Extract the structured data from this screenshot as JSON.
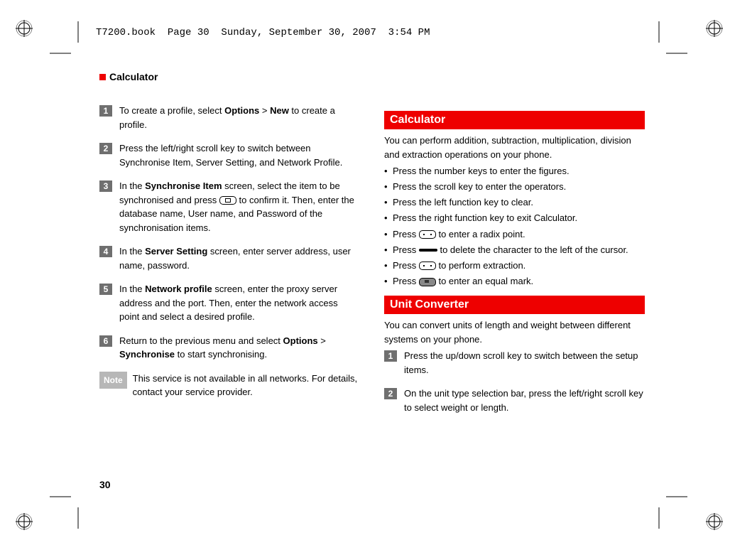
{
  "header_runner": "T7200.book  Page 30  Sunday, September 30, 2007  3:54 PM",
  "section_header": "Calculator",
  "page_number": "30",
  "left": {
    "steps": [
      {
        "n": "1",
        "pre": "To create a profile, select ",
        "b1": "Options",
        "mid": " > ",
        "b2": "New",
        "post": " to create a profile."
      },
      {
        "n": "2",
        "text": "Press the left/right scroll key to switch between Synchronise Item, Server Setting, and Network Profile."
      },
      {
        "n": "3",
        "pre": "In the ",
        "b1": "Synchronise Item",
        "mid": " screen, select the item to be synchronised and press ",
        "post": " to confirm it. Then, enter the database name, User name, and Password of the synchronisation items."
      },
      {
        "n": "4",
        "pre": "In the ",
        "b1": "Server Setting",
        "post": " screen, enter server address,  user name, password."
      },
      {
        "n": "5",
        "pre": "In the ",
        "b1": "Network profile",
        "post": " screen, enter the proxy server address and the port. Then, enter the network access point and select a desired profile."
      },
      {
        "n": "6",
        "pre": "Return to the previous menu and select ",
        "b1": "Options",
        "mid": " > ",
        "b2": "Synchronise",
        "post": " to start synchronising."
      }
    ],
    "note_label": "Note",
    "note_text": "This service is not available in all networks. For details, contact your service provider."
  },
  "right": {
    "calc_heading": "Calculator",
    "calc_intro": "You can perform addition, subtraction, multiplication, division and extraction operations on your phone.",
    "calc_bullets": [
      "Press the number keys to enter the figures.",
      "Press the scroll key to enter the operators.",
      "Press the left function key to clear.",
      "Press the right function key to exit Calculator."
    ],
    "calc_b5_pre": "Press ",
    "calc_b5_post": " to enter a radix point.",
    "calc_b6_pre": "Press ",
    "calc_b6_post": " to delete the character to the left of the cursor.",
    "calc_b7_pre": "Press ",
    "calc_b7_post": " to perform extraction.",
    "calc_b8_pre": "Press ",
    "calc_b8_post": " to enter an equal mark.",
    "unit_heading": "Unit Converter",
    "unit_intro": "You can convert units of length and weight between different systems on your phone.",
    "unit_steps": [
      {
        "n": "1",
        "text": "Press the up/down scroll key to switch between the setup items."
      },
      {
        "n": "2",
        "text": "On the unit type selection bar, press the left/right scroll key to select weight or length."
      }
    ]
  }
}
